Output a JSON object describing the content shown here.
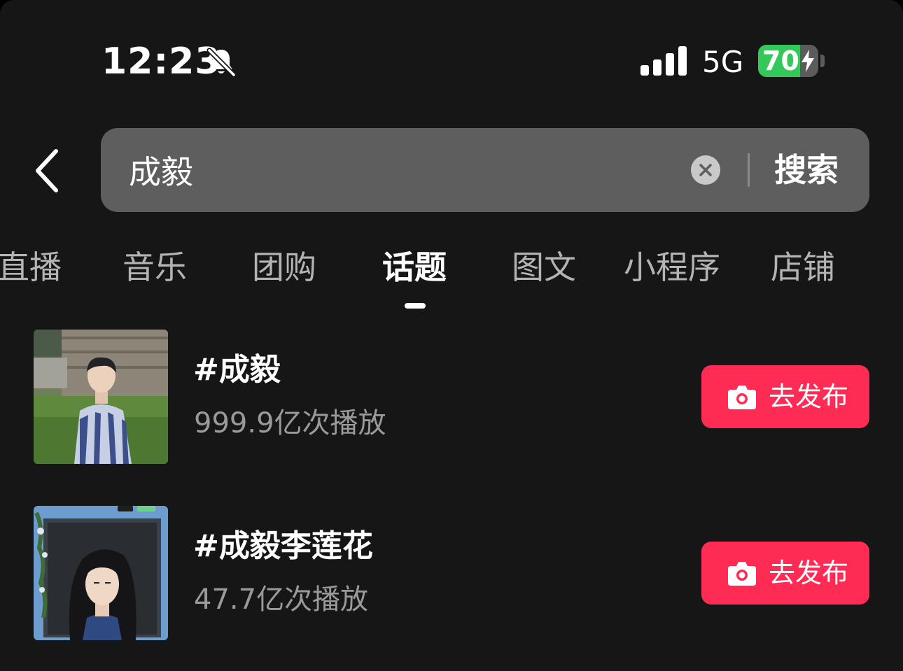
{
  "status_bar": {
    "time": "12:23",
    "network": "5G",
    "battery_percent": "70",
    "battery_level": 0.7,
    "mute_icon": "bell-slash-icon",
    "signal_icon": "signal-bars-icon",
    "charging_icon": "bolt-icon"
  },
  "search": {
    "back_icon": "chevron-left-icon",
    "query": "成毅",
    "clear_icon": "clear-circle-x-icon",
    "submit_label": "搜索"
  },
  "tabs": [
    {
      "label": "直播"
    },
    {
      "label": "音乐"
    },
    {
      "label": "团购"
    },
    {
      "label": "话题",
      "active": true
    },
    {
      "label": "图文"
    },
    {
      "label": "小程序"
    },
    {
      "label": "店铺"
    }
  ],
  "topics": [
    {
      "title": "#成毅",
      "plays": "999.9亿次播放",
      "button_label": "去发布",
      "thumbnail": "photo-man-striped-shirt-outdoors"
    },
    {
      "title": "#成毅李莲花",
      "plays": "47.7亿次播放",
      "button_label": "去发布",
      "thumbnail": "photo-long-hair-costume-framed"
    }
  ],
  "colors": {
    "background": "#161616",
    "search_box": "#5e5e5e",
    "accent": "#fe2c55",
    "battery_green": "#34c759",
    "muted_text": "#9a9a9a"
  }
}
